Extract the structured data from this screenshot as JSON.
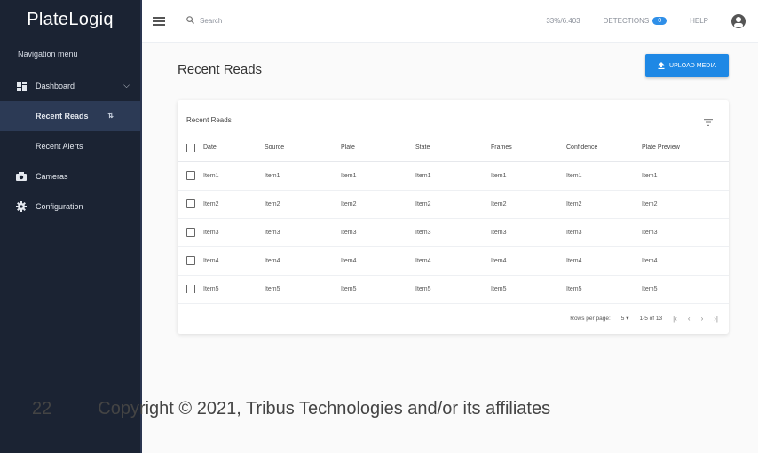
{
  "app": {
    "title": "PlateLogiq"
  },
  "sidebar": {
    "heading": "Navigation menu",
    "items": [
      {
        "label": "Dashboard",
        "icon": "dashboard-icon"
      },
      {
        "label": "Recent Reads",
        "icon": ""
      },
      {
        "label": "Recent Alerts",
        "icon": ""
      },
      {
        "label": "Cameras",
        "icon": "camera-icon"
      },
      {
        "label": "Configuration",
        "icon": "gear-icon"
      }
    ]
  },
  "topbar": {
    "search_placeholder": "Search",
    "stats": "33%/6.403",
    "detections_label": "DETECTIONS",
    "detections_count": "0",
    "help_label": "HELP"
  },
  "main": {
    "title": "Recent Reads",
    "upload_label": "UPLOAD MEDIA",
    "card_title": "Recent Reads"
  },
  "table": {
    "headers": [
      "Date",
      "Source",
      "Plate",
      "State",
      "Frames",
      "Confidence",
      "Plate Preview"
    ],
    "rows": [
      [
        "Item1",
        "Item1",
        "Item1",
        "Item1",
        "Item1",
        "Item1",
        "Item1"
      ],
      [
        "Item2",
        "Item2",
        "Item2",
        "Item2",
        "Item2",
        "Item2",
        "Item2"
      ],
      [
        "Item3",
        "Item3",
        "Item3",
        "Item3",
        "Item3",
        "Item3",
        "Item3"
      ],
      [
        "Item4",
        "Item4",
        "Item4",
        "Item4",
        "Item4",
        "Item4",
        "Item4"
      ],
      [
        "Item5",
        "Item5",
        "Item5",
        "Item5",
        "Item5",
        "Item5",
        "Item5"
      ]
    ]
  },
  "pagination": {
    "rows_per_page_label": "Rows per page:",
    "rows_per_page_value": "5",
    "range": "1-5 of 13"
  },
  "footer": {
    "page_number": "22",
    "copyright": "Copyright © 2021, Tribus Technologies and/or its affiliates"
  },
  "colors": {
    "sidebar_bg": "#1b2333",
    "accent": "#1e88e5"
  }
}
